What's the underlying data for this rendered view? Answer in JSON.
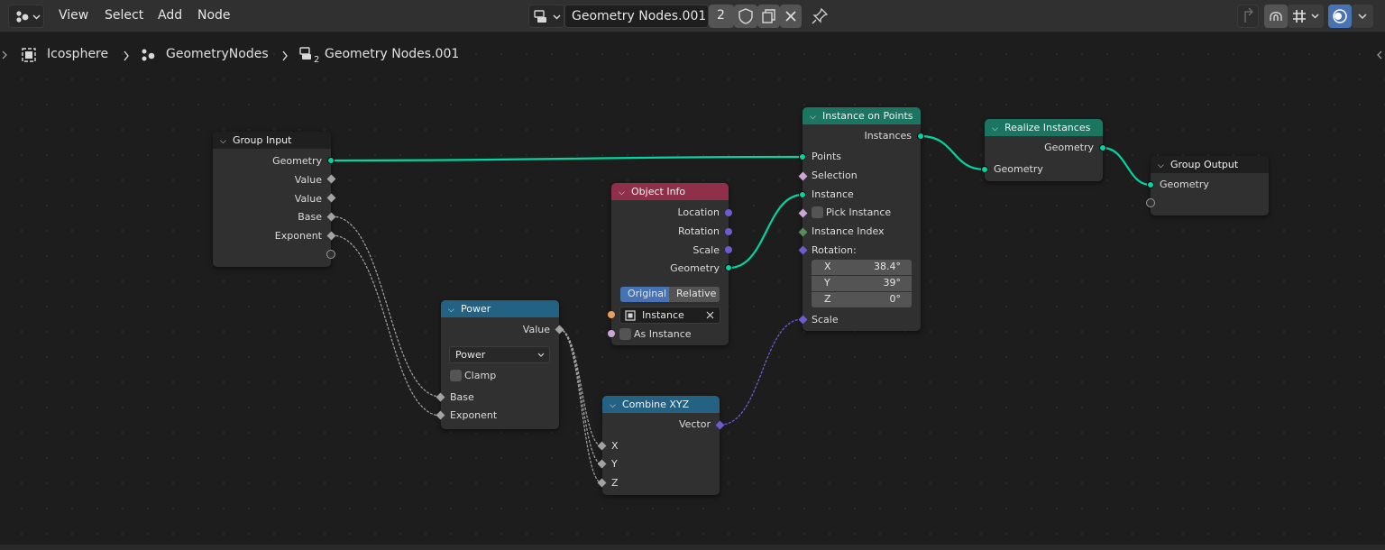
{
  "colors": {
    "geometry_wire": "#00d6a3",
    "vector_wire": "#6e5bd0",
    "float_wire": "#a3a3a3",
    "header_geometry": "#1b7560",
    "header_input": "#8f2f4a",
    "header_converter": "#246283",
    "header_group": "#1f1f1f"
  },
  "header": {
    "menus": [
      "View",
      "Select",
      "Add",
      "Node"
    ],
    "node_tree_name": "Geometry Nodes.001",
    "user_count": "2",
    "icons": [
      "editor-type-icon",
      "node-tree-type-icon",
      "fake-user-shield-icon",
      "duplicate-icon",
      "close-icon",
      "pin-icon",
      "parent-node-tree-icon",
      "snap-icon",
      "snap-mode-icon",
      "overlay-icon"
    ]
  },
  "breadcrumbs": [
    "Icosphere",
    "GeometryNodes",
    "Geometry Nodes.001"
  ],
  "breadcrumb_badge": "2",
  "nodes": {
    "group_input": {
      "title": "Group Input",
      "outputs": [
        "Geometry",
        "Value",
        "Value",
        "Base",
        "Exponent"
      ]
    },
    "power": {
      "title": "Power",
      "output": "Value",
      "operation": "Power",
      "clamp": "Clamp",
      "inputs": [
        "Base",
        "Exponent"
      ]
    },
    "object_info": {
      "title": "Object Info",
      "outputs": [
        "Location",
        "Rotation",
        "Scale",
        "Geometry"
      ],
      "mode_options": [
        "Original",
        "Relative"
      ],
      "object_field": "Instance",
      "as_instance": "As Instance"
    },
    "combine_xyz": {
      "title": "Combine XYZ",
      "output": "Vector",
      "inputs": [
        "X",
        "Y",
        "Z"
      ]
    },
    "instance_on_points": {
      "title": "Instance on Points",
      "output": "Instances",
      "inputs": [
        "Points",
        "Selection",
        "Instance",
        "Pick Instance",
        "Instance Index",
        "Rotation:",
        "Scale"
      ],
      "rotation": {
        "x_label": "X",
        "x_value": "38.4°",
        "y_label": "Y",
        "y_value": "39°",
        "z_label": "Z",
        "z_value": "0°"
      }
    },
    "realize_instances": {
      "title": "Realize Instances",
      "output": "Geometry",
      "input": "Geometry"
    },
    "group_output": {
      "title": "Group Output",
      "input": "Geometry"
    }
  }
}
